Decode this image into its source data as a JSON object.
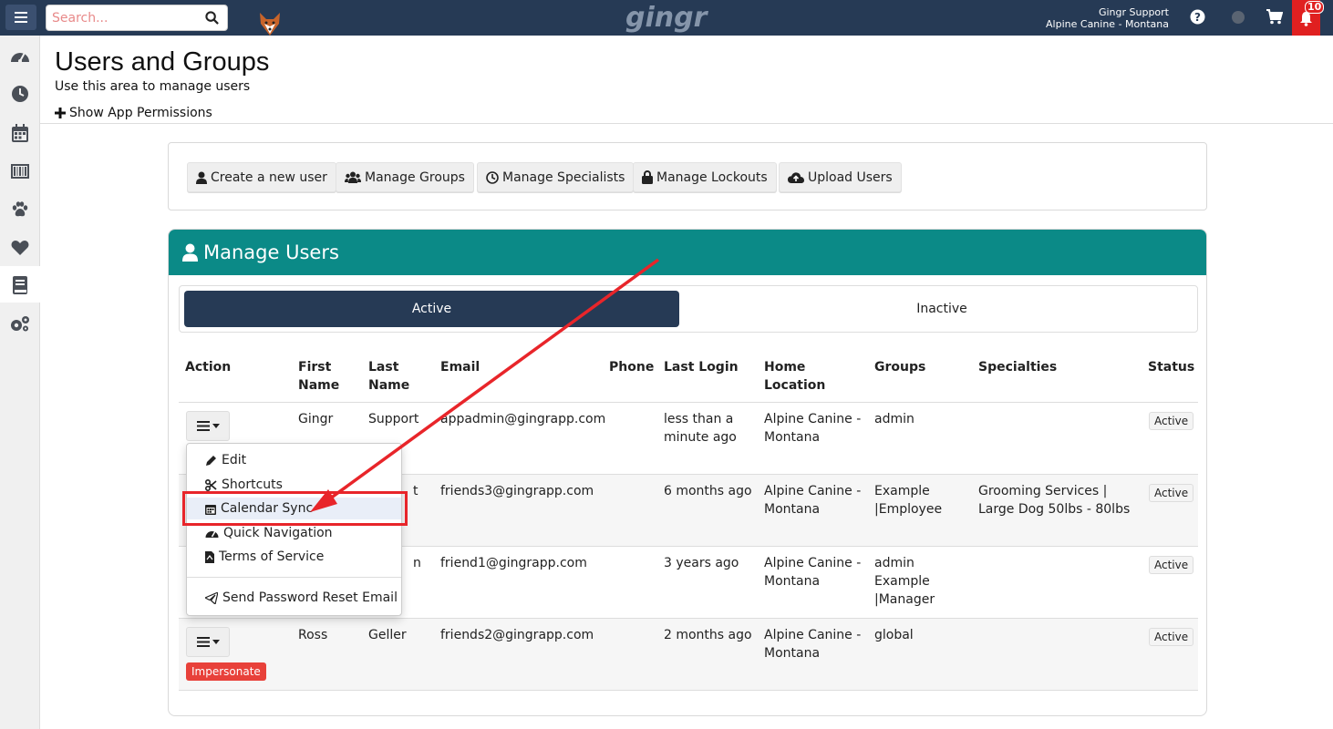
{
  "topbar": {
    "search_placeholder": "Search...",
    "logo": "gingr",
    "user_name": "Gingr Support",
    "user_location": "Alpine Canine - Montana",
    "notification_count": "10"
  },
  "page": {
    "title": "Users and Groups",
    "subtitle": "Use this area to manage users",
    "permissions_toggle": "Show App Permissions"
  },
  "toolbar": {
    "create_user": "Create a new user",
    "manage_groups": "Manage Groups",
    "manage_specialists": "Manage Specialists",
    "manage_lockouts": "Manage Lockouts",
    "upload_users": "Upload Users"
  },
  "panel": {
    "title": "Manage Users",
    "tab_active": "Active",
    "tab_inactive": "Inactive"
  },
  "table": {
    "headers": {
      "action": "Action",
      "first_name_1": "First",
      "first_name_2": "Name",
      "last_name_1": "Last",
      "last_name_2": "Name",
      "email": "Email",
      "phone": "Phone",
      "last_login": "Last Login",
      "home_location_1": "Home",
      "home_location_2": "Location",
      "groups": "Groups",
      "specialties": "Specialties",
      "status": "Status"
    },
    "rows": [
      {
        "first": "Gingr",
        "last": "Support",
        "email": "appadmin@gingrapp.com",
        "login_1": "less than a",
        "login_2": "minute ago",
        "loc_1": "Alpine Canine -",
        "loc_2": "Montana",
        "groups_1": "admin",
        "groups_2": "",
        "groups_3": "",
        "spec_1": "",
        "spec_2": "",
        "status": "Active"
      },
      {
        "first": "",
        "last": "t",
        "email": "friends3@gingrapp.com",
        "login_1": "6 months ago",
        "login_2": "",
        "loc_1": "Alpine Canine -",
        "loc_2": "Montana",
        "groups_1": "Example",
        "groups_2": "|Employee",
        "groups_3": "",
        "spec_1": "Grooming Services |",
        "spec_2": "Large Dog 50lbs - 80lbs",
        "status": "Active"
      },
      {
        "first": "",
        "last": "n",
        "email": "friend1@gingrapp.com",
        "login_1": "3 years ago",
        "login_2": "",
        "loc_1": "Alpine Canine -",
        "loc_2": "Montana",
        "groups_1": "admin",
        "groups_2": "Example",
        "groups_3": "|Manager",
        "spec_1": "",
        "spec_2": "",
        "status": "Active"
      },
      {
        "first": "Ross",
        "last": "Geller",
        "email": "friends2@gingrapp.com",
        "login_1": "2 months ago",
        "login_2": "",
        "loc_1": "Alpine Canine -",
        "loc_2": "Montana",
        "groups_1": "global",
        "groups_2": "",
        "groups_3": "",
        "spec_1": "",
        "spec_2": "",
        "status": "Active",
        "impersonate": "Impersonate"
      }
    ]
  },
  "dropdown": {
    "edit": "Edit",
    "shortcuts": "Shortcuts",
    "calendar_sync": "Calendar Sync",
    "quick_navigation": "Quick Navigation",
    "terms": "Terms of Service",
    "reset_password": "Send Password Reset Email"
  },
  "colors": {
    "topbar": "#263a55",
    "panel_header": "#0b8a87",
    "highlight": "#e8252a"
  }
}
